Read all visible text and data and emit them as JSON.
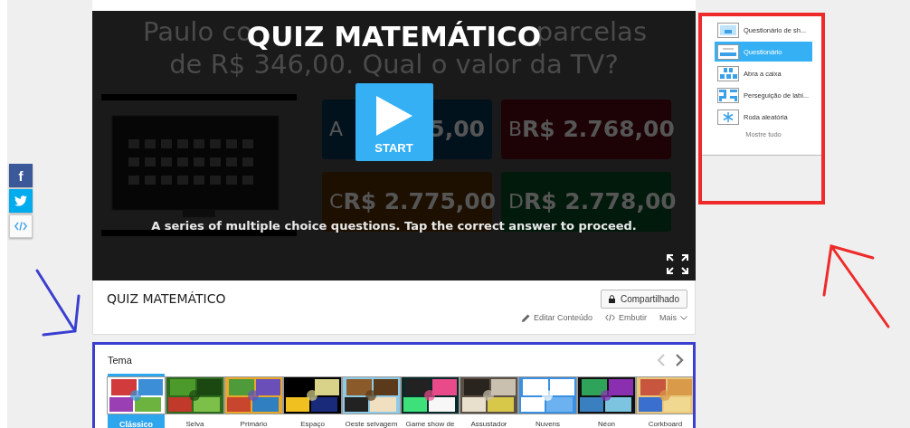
{
  "social": [
    {
      "kind": "facebook",
      "label": "f"
    },
    {
      "kind": "twitter"
    },
    {
      "kind": "embed"
    }
  ],
  "player": {
    "preview": {
      "question_line_1": [
        "Paulo co",
        "parcelas"
      ],
      "question_line_2": "de R$ 346,00. Qual o valor da TV?",
      "answers": [
        {
          "letter": "A",
          "value": "5,00",
          "color": "#02121d"
        },
        {
          "letter": "B",
          "value": "R$ 2.768,00",
          "color": "#1d0306"
        },
        {
          "letter": "C",
          "value": "R$ 2.775,00",
          "color": "#1d1000"
        },
        {
          "letter": "D",
          "value": "R$ 2.778,00",
          "color": "#021a0b"
        }
      ]
    },
    "title": "QUIZ MATEMÁTICO",
    "start_label": "START",
    "description": "A series of multiple choice questions. Tap the correct answer to proceed."
  },
  "info": {
    "title": "QUIZ MATEMÁTICO",
    "share_button": "Compartilhado",
    "actions": [
      {
        "kind": "edit",
        "label": "Editar Conteúdo"
      },
      {
        "kind": "embed",
        "label": "Embutir"
      },
      {
        "kind": "more",
        "label": "Mais"
      }
    ]
  },
  "theme": {
    "title": "Tema",
    "themes": [
      {
        "label": "Clássico",
        "selected": true
      },
      {
        "label": "Selva",
        "selected": false
      },
      {
        "label": "Primário",
        "selected": false
      },
      {
        "label": "Espaço",
        "selected": false
      },
      {
        "label": "Oeste selvagem",
        "selected": false
      },
      {
        "label": "Game show de",
        "selected": false
      },
      {
        "label": "Assustador",
        "selected": false
      },
      {
        "label": "Nuvens",
        "selected": false
      },
      {
        "label": "Néon",
        "selected": false
      },
      {
        "label": "Corkboard",
        "selected": false
      }
    ]
  },
  "templates": {
    "items": [
      {
        "label": "Questionário de sh...",
        "selected": false
      },
      {
        "label": "Questionário",
        "selected": true
      },
      {
        "label": "Abra a caixa",
        "selected": false
      },
      {
        "label": "Perseguição de labi...",
        "selected": false
      },
      {
        "label": "Roda aleatória",
        "selected": false
      }
    ],
    "show_all": "Mostre tudo"
  }
}
